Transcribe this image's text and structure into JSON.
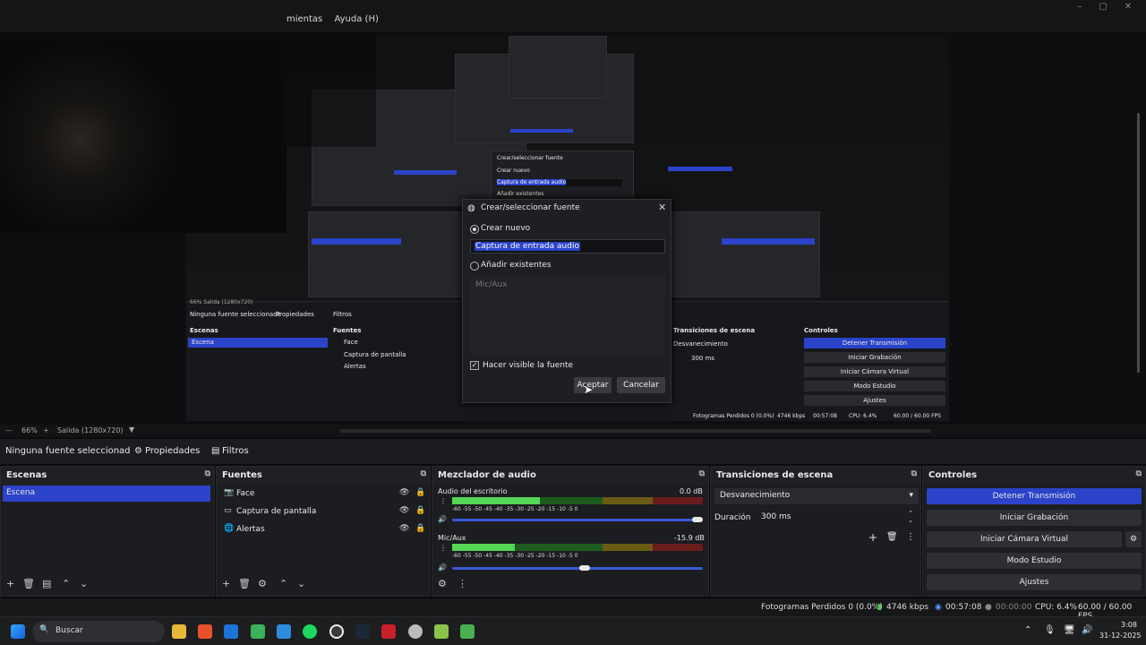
{
  "menu": {
    "items": [
      "mientas",
      "Ayuda (H)"
    ]
  },
  "preview": {
    "nested_texts": {
      "dialog_title": "Crear/seleccionar fuente",
      "crear_nuevo": "Crear nuevo",
      "input": "Captura de entrada audio",
      "anadir": "Añadir existentes",
      "no_source": "Ninguna fuente seleccionada",
      "propiedades": "Propiedades",
      "filtros": "Filtros",
      "escenas": "Escenas",
      "escena": "Escena",
      "fuentes": "Fuentes",
      "face": "Face",
      "captura_pantalla": "Captura de pantalla",
      "alertas": "Alertas",
      "zoom": "66%",
      "salida": "Salida (1280x720)",
      "transiciones": "Transiciones de escena",
      "desvanecimiento": "Desvanecimiento",
      "duracion": "300 ms",
      "controles": "Controles",
      "detener": "Detener Transmisión",
      "iniciar_grab": "Iniciar Grabación",
      "camara": "Iniciar Cámara Virtual",
      "modo": "Modo Estudio",
      "ajustes": "Ajustes",
      "status": "Fotogramas Perdidos 0 (0.0%)",
      "kbps": "4746 kbps",
      "time": "00:57:08",
      "rec": "00:00:00",
      "cpu": "CPU: 6.4%",
      "fps": "60.00 / 60.00 FPS"
    }
  },
  "dialog": {
    "title": "Crear/seleccionar fuente",
    "close": "✕",
    "crear_nuevo": "Crear nuevo",
    "input_value": "Captura de entrada audio",
    "anadir": "Añadir existentes",
    "existing_item": "Mic/Aux",
    "visible_label": "Hacer visible la fuente",
    "visible_checked": true,
    "accept": "Aceptar",
    "cancel": "Cancelar"
  },
  "toolbar": {
    "zoom": "66%",
    "plus": "+",
    "output": "Salida (1280x720)"
  },
  "props_bar": {
    "no_source": "Ninguna fuente seleccionad",
    "properties": "Propiedades",
    "filters": "Filtros"
  },
  "scenes": {
    "title": "Escenas",
    "items": [
      "Escena"
    ]
  },
  "sources": {
    "title": "Fuentes",
    "items": [
      {
        "label": "Face",
        "icon": "camera-icon"
      },
      {
        "label": "Captura de pantalla",
        "icon": "monitor-icon"
      },
      {
        "label": "Alertas",
        "icon": "globe-icon"
      }
    ]
  },
  "mixer": {
    "title": "Mezclador de audio",
    "channels": [
      {
        "name": "Audio del escritorio",
        "db": "0.0 dB",
        "level": 0.35,
        "volume": 1.0
      },
      {
        "name": "Mic/Aux",
        "db": "-15.9 dB",
        "level": 0.25,
        "volume": 0.55
      }
    ],
    "ticks": "-60  -55  -50  -45  -40  -35  -30  -25  -20  -15  -10  -5  0"
  },
  "transitions": {
    "title": "Transiciones de escena",
    "selected": "Desvanecimiento",
    "duration_label": "Duración",
    "duration_value": "300 ms"
  },
  "controls": {
    "title": "Controles",
    "buttons": [
      "Detener Transmisión",
      "Iniciar Grabación",
      "Iniciar Cámara Virtual",
      "Modo Estudio",
      "Ajustes"
    ]
  },
  "status": {
    "dropped": "Fotogramas Perdidos 0 (0.0%)",
    "bitrate": "4746 kbps",
    "stream_time": "00:57:08",
    "rec_time": "00:00:00",
    "cpu": "CPU: 6.4%",
    "fps": "60.00 / 60.00 FPS"
  },
  "taskbar": {
    "search": "Buscar",
    "time": "3:08",
    "date": "31-12-2025"
  },
  "colors": {
    "accent": "#2b43c9",
    "panel": "#1c1d20",
    "background": "#0b0b0d"
  }
}
